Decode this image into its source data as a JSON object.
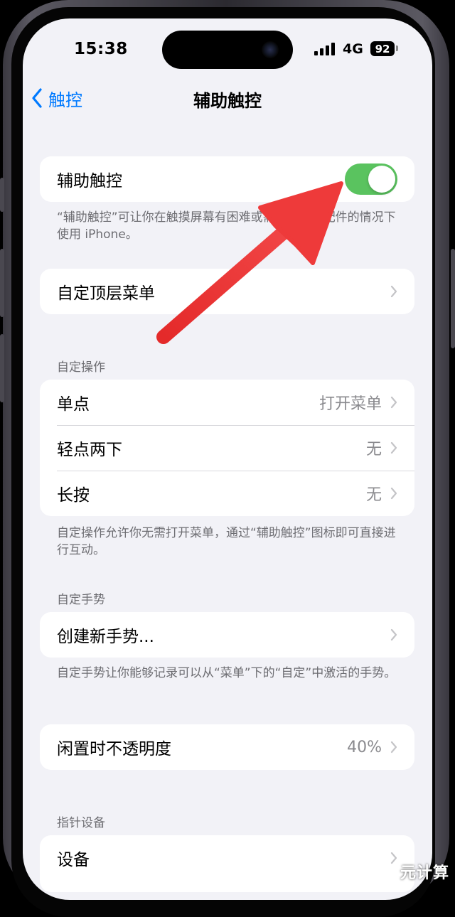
{
  "status_bar": {
    "time": "15:38",
    "network": "4G",
    "battery": "92"
  },
  "nav": {
    "back_label": "触控",
    "title": "辅助触控"
  },
  "assistive_touch": {
    "label": "辅助触控",
    "toggle_on": true,
    "toggle_color": "#5ac35f",
    "footnote": "“辅助触控”可让你在触摸屏幕有困难或需要自适应配件的情况下使用 iPhone。"
  },
  "top_menu": {
    "label": "自定顶层菜单"
  },
  "custom_actions": {
    "header": "自定操作",
    "rows": [
      {
        "label": "单点",
        "value": "打开菜单"
      },
      {
        "label": "轻点两下",
        "value": "无"
      },
      {
        "label": "长按",
        "value": "无"
      }
    ],
    "footnote": "自定操作允许你无需打开菜单，通过“辅助触控”图标即可直接进行互动。"
  },
  "custom_gestures": {
    "header": "自定手势",
    "create_label": "创建新手势...",
    "footnote": "自定手势让你能够记录可以从“菜单”下的“自定”中激活的手势。"
  },
  "idle_opacity": {
    "label": "闲置时不透明度",
    "value": "40%"
  },
  "pointer_devices": {
    "header": "指针设备",
    "devices_label": "设备"
  },
  "annotation": {
    "arrow_color": "#ee3a3a",
    "arrow_target": "toggle"
  },
  "watermark": "元计算",
  "colors": {
    "accent": "#007aff",
    "background": "#f2f2f7"
  }
}
